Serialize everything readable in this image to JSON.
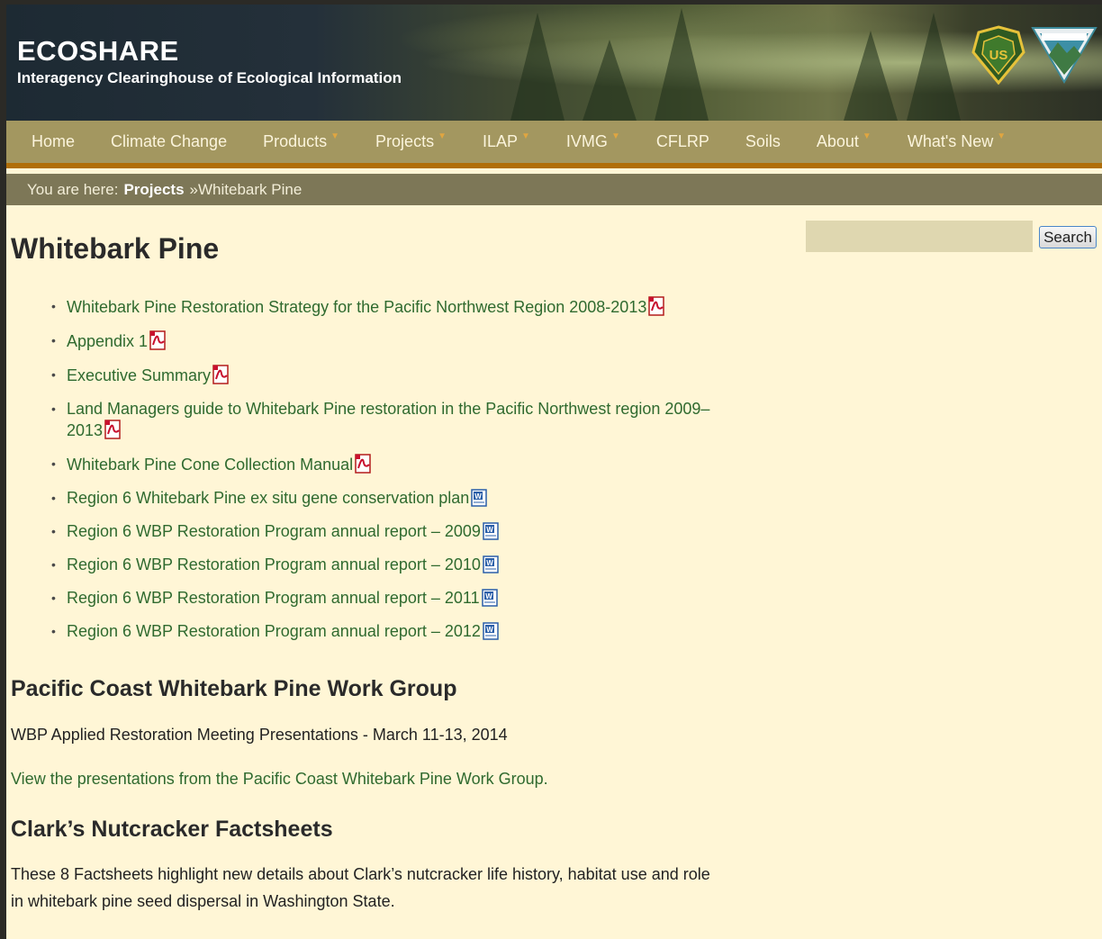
{
  "header": {
    "title": "ECOSHARE",
    "subtitle": "Interagency Clearinghouse of Ecological Information"
  },
  "nav": {
    "items": [
      {
        "label": "Home",
        "dropdown": false
      },
      {
        "label": "Climate Change",
        "dropdown": false
      },
      {
        "label": "Products",
        "dropdown": true
      },
      {
        "label": "Projects",
        "dropdown": true
      },
      {
        "label": "ILAP",
        "dropdown": true
      },
      {
        "label": "IVMG",
        "dropdown": true
      },
      {
        "label": "CFLRP",
        "dropdown": false
      },
      {
        "label": "Soils",
        "dropdown": false
      },
      {
        "label": "About",
        "dropdown": true
      },
      {
        "label": "What's New",
        "dropdown": true
      }
    ]
  },
  "breadcrumb": {
    "prefix": "You are here:",
    "parent": "Projects",
    "current": "»Whitebark Pine"
  },
  "search": {
    "placeholder": "",
    "button_label": "Search"
  },
  "main": {
    "title": "Whitebark Pine",
    "documents": [
      {
        "label": "Whitebark Pine Restoration Strategy for the Pacific Northwest Region 2008-2013",
        "icon": "pdf-icon"
      },
      {
        "label": "Appendix 1",
        "icon": "pdf-icon"
      },
      {
        "label": "Executive Summary",
        "icon": "pdf-icon"
      },
      {
        "label": "Land Managers guide to Whitebark Pine restoration in the Pacific Northwest region 2009–2013",
        "icon": "pdf-icon"
      },
      {
        "label": "Whitebark Pine Cone Collection Manual",
        "icon": "pdf-icon"
      },
      {
        "label": "Region 6 Whitebark Pine ex situ gene conservation plan",
        "icon": "word-doc-icon"
      },
      {
        "label": "Region 6 WBP Restoration Program annual report – 2009",
        "icon": "word-doc-icon"
      },
      {
        "label": "Region 6 WBP Restoration Program annual report – 2010",
        "icon": "word-doc-icon"
      },
      {
        "label": "Region 6 WBP Restoration Program annual report – 2011",
        "icon": "word-doc-icon"
      },
      {
        "label": "Region 6 WBP Restoration Program annual report – 2012",
        "icon": "word-doc-icon"
      }
    ],
    "workgroup": {
      "heading": "Pacific Coast Whitebark Pine Work Group",
      "meeting_text": "WBP Applied Restoration Meeting Presentations - March 11-13, 2014",
      "link_text": "View the presentations from the Pacific Coast Whitebark Pine Work Group."
    },
    "nutcracker": {
      "heading": "Clark’s Nutcracker Factsheets",
      "text": "These 8 Factsheets highlight new details about Clark’s nutcracker life history, habitat use and role in whitebark pine seed dispersal in Washington State."
    }
  },
  "colors": {
    "page_bg": "#fff6d6",
    "nav_bg": "#a39760",
    "nav_border": "#b06e08",
    "breadcrumb_bg": "#7d7757",
    "link": "#2f6a2f"
  }
}
